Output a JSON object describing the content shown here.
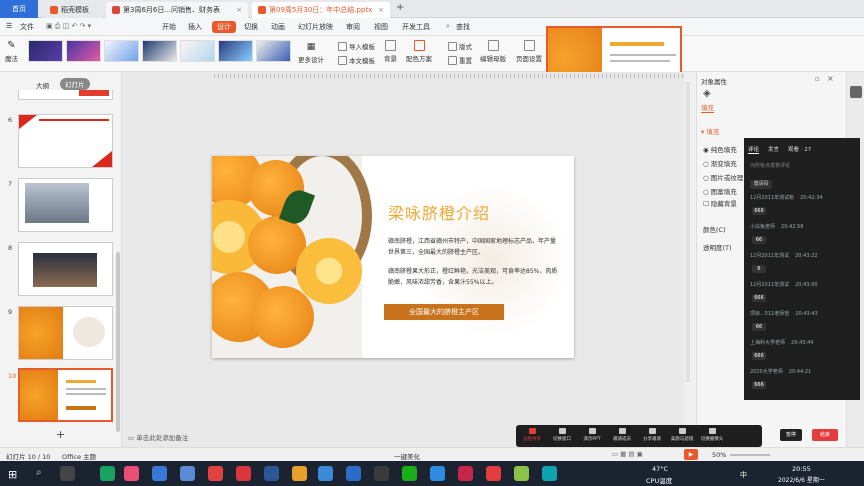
{
  "tabs": {
    "home": "首页",
    "t1": "稻壳模板",
    "t2": "第3周6月6日...问销售、财务表",
    "t3": "第09周5月30日：年中总结.pptx"
  },
  "menu": {
    "file": "文件",
    "start": "开始",
    "insert": "插入",
    "design": "设计",
    "switch": "切换",
    "animation": "动画",
    "slideshow": "幻灯片放映",
    "review": "审阅",
    "view": "视图",
    "dev": "开发工具",
    "search": "查找"
  },
  "ribbon": {
    "magic": "魔法",
    "more_design": "更多设计",
    "import_template": "导入模板",
    "this_template": "本文模板",
    "background": "背景",
    "color_scheme": "配色方案",
    "format": "版式",
    "reset": "重置",
    "edit_master": "编辑母版",
    "page_setup": "页面设置"
  },
  "leftpanel": {
    "outline": "大纲",
    "slides": "幻灯片",
    "nums": [
      "6",
      "7",
      "8",
      "9",
      "10"
    ],
    "add": "+"
  },
  "slide": {
    "title": "梁咏脐橙介绍",
    "p1": "赣南脐橙，江西省赣州市特产，中国国家地理标志产品，年产量世界第三，全国最大的脐橙主产区。",
    "p2": "赣南脐橙果大形正，橙红鲜艳，光洁美观，可食率达85%，肉质脆嫩，风味浓甜芳香，含果汁55%以上。",
    "banner": "全国最大的脐橙主产区"
  },
  "rightpanel": {
    "header": "对象属性",
    "fill_tab": "填充",
    "fill_section": "填充",
    "opt1": "纯色填充",
    "opt2": "渐变填充",
    "opt3": "图片或纹理",
    "opt4": "图案填充",
    "opt5": "隐藏背景",
    "color_label": "颜色(C)",
    "transparency_label": "透明度(T)"
  },
  "chat": {
    "tab1": "评论",
    "tab2": "发言",
    "tab3": "观看 · 27",
    "hint": "为所有点发表评论",
    "btn": "邀请码",
    "msgs": [
      {
        "who": "12月2011年测试帐",
        "time": "20:42:34",
        "num": "666"
      },
      {
        "who": "小白兔老师",
        "time": "20:42:58",
        "num": "66"
      },
      {
        "who": "12月2011年测试",
        "time": "20:43:22",
        "num": "6"
      },
      {
        "who": "12月2011年测试",
        "time": "20:43:00",
        "num": "666"
      },
      {
        "who": "项目...511老师管",
        "time": "20:43:43",
        "num": "66"
      },
      {
        "who": "上海科大学老师",
        "time": "20:43:44",
        "num": "666"
      },
      {
        "who": "2020大学老师",
        "time": "20:44:21",
        "num": "666"
      }
    ]
  },
  "status": {
    "notes": "单击此处添加备注",
    "slide_info": "幻灯片 10 / 10",
    "theme": "Office 主题",
    "beautify": "一键美化",
    "zoom": "50%"
  },
  "meeting": {
    "items": [
      "远程共享",
      "切换窗口",
      "演示PPT",
      "邀请成员",
      "分享邀请",
      "美颜与滤镜",
      "切换摄像头"
    ],
    "pause": "暂停",
    "end": "结束"
  },
  "taskbar": {
    "temp": "47°C",
    "cpu": "CPU温度",
    "time": "20:55",
    "date": "2022/6/6 星期一",
    "ime": "中"
  },
  "colors": {
    "accent": "#e8592b",
    "orange": "#f2a32a",
    "banner": "#c8731c",
    "title": "#f0a830"
  }
}
